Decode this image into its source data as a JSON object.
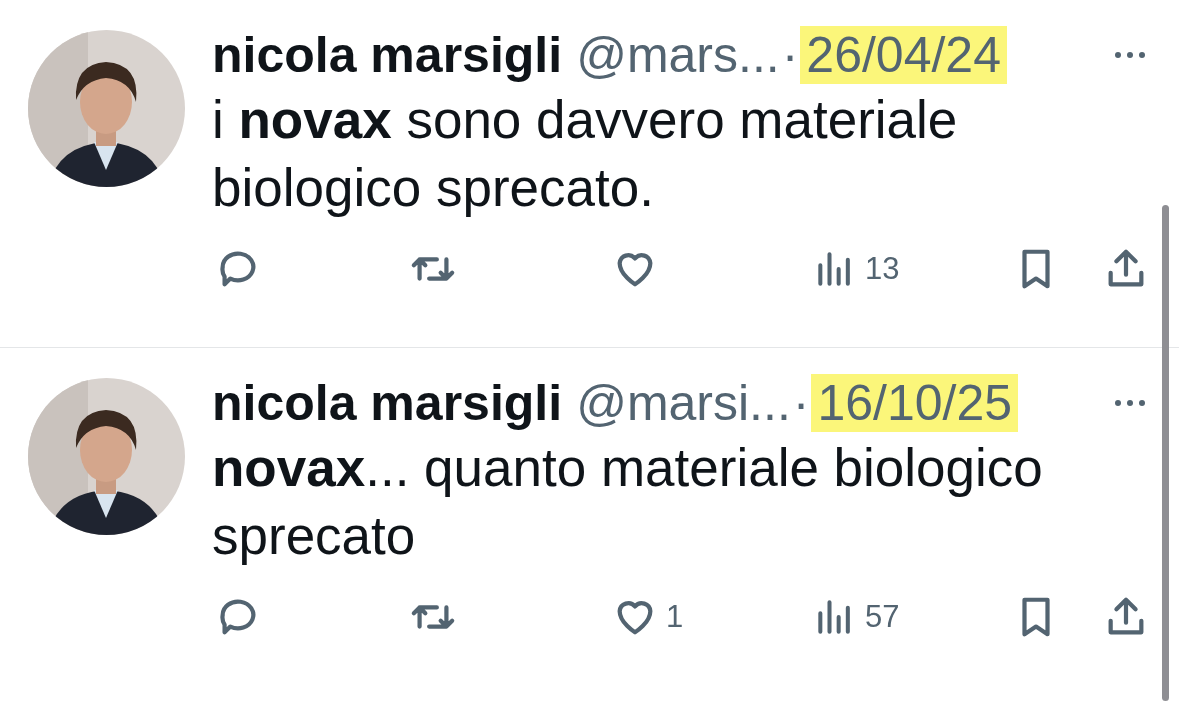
{
  "tweets": [
    {
      "name": "nicola marsigli",
      "handle": "@mars...",
      "separator": "·",
      "date": "26/04/24",
      "date_highlighted": true,
      "text": "i **novax** sono davvero materiale biologico sprecato.",
      "views": "13"
    },
    {
      "name": "nicola marsigli",
      "handle": "@marsi...",
      "separator": "·",
      "date": "16/10/25",
      "date_highlighted": true,
      "text": "**novax**... quanto materiale biologico sprecato",
      "likes": "1",
      "views": "57"
    }
  ]
}
